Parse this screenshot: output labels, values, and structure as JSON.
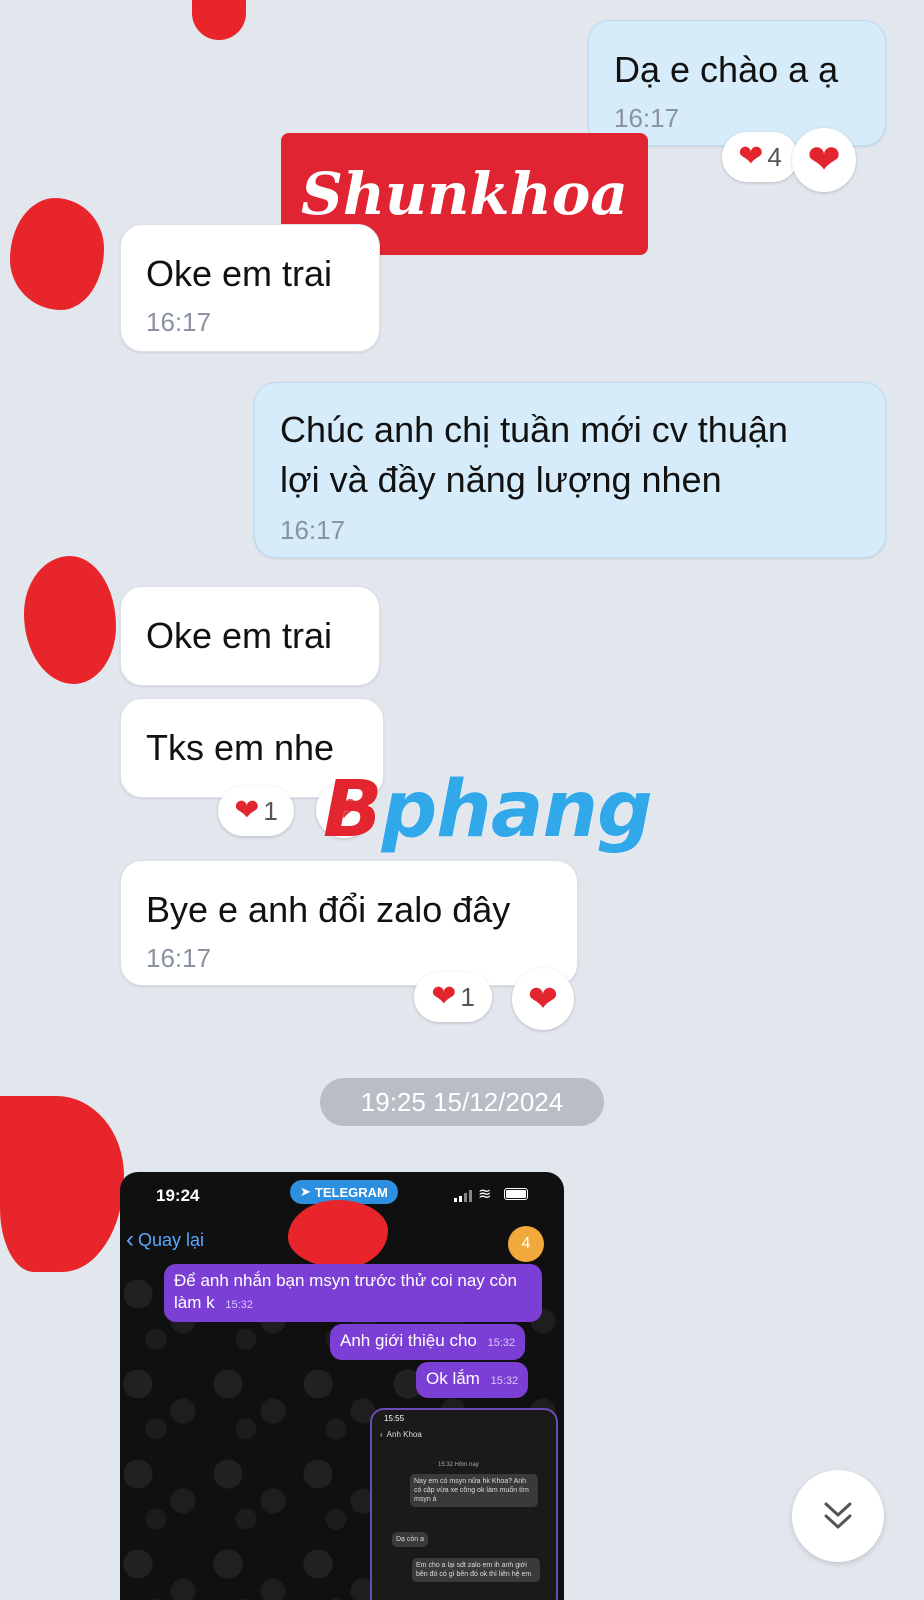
{
  "messages": [
    {
      "text": "Dạ e chào a ạ",
      "time": "16:17"
    },
    {
      "text": "Oke em trai",
      "time": "16:17"
    },
    {
      "line1": "Chúc anh chị tuần mới cv thuận",
      "line2": "lợi và đầy năng lượng nhen",
      "time": "16:17"
    },
    {
      "text": "Oke em trai"
    },
    {
      "text": "Tks em nhe"
    },
    {
      "text": "Bye e anh đổi zalo đây",
      "time": "16:17"
    }
  ],
  "reactions": {
    "msg1_count": "4",
    "msg5_count": "1",
    "msg6_count": "1"
  },
  "date_divider": "19:25 15/12/2024",
  "overlays": {
    "logo_text": "Shunkhoa",
    "watermark_text": "Bphang"
  },
  "embedded_screenshot": {
    "status_time": "19:24",
    "app_badge": "TELEGRAM",
    "back_label": "Quay lại",
    "unread_count": "4",
    "messages": [
      {
        "text": "Để anh nhắn bạn msyn trước thử coi nay còn làm k",
        "time": "15:32"
      },
      {
        "text": "Anh giới thiệu cho",
        "time": "15:32"
      },
      {
        "text": "Ok lắm",
        "time": "15:32"
      }
    ],
    "inner_phone": {
      "status_time": "15:55",
      "contact_name": "Anh Khoa",
      "divider": "15:32 Hôm nay",
      "msg1": "Nay em có msyn nữa hk Khoa? Anh có cặp vừa xe công ok làm muốn tìm msyn á",
      "msg2": "Dạ còn a",
      "msg3": "Em cho a lại sdt zalo em ih anh giới bên đó có gì bên đó ok thì liên hệ em"
    }
  },
  "colors": {
    "background": "#e2e6ed",
    "outgoing_bubble": "#d6ecfa",
    "incoming_bubble": "#ffffff",
    "heart": "#e2252e",
    "telegram_bubble": "#7b3fd6"
  },
  "icons": [
    "heart-icon",
    "chevron-double-down-icon",
    "chevron-left-icon",
    "signal-icon",
    "wifi-icon",
    "battery-icon"
  ]
}
